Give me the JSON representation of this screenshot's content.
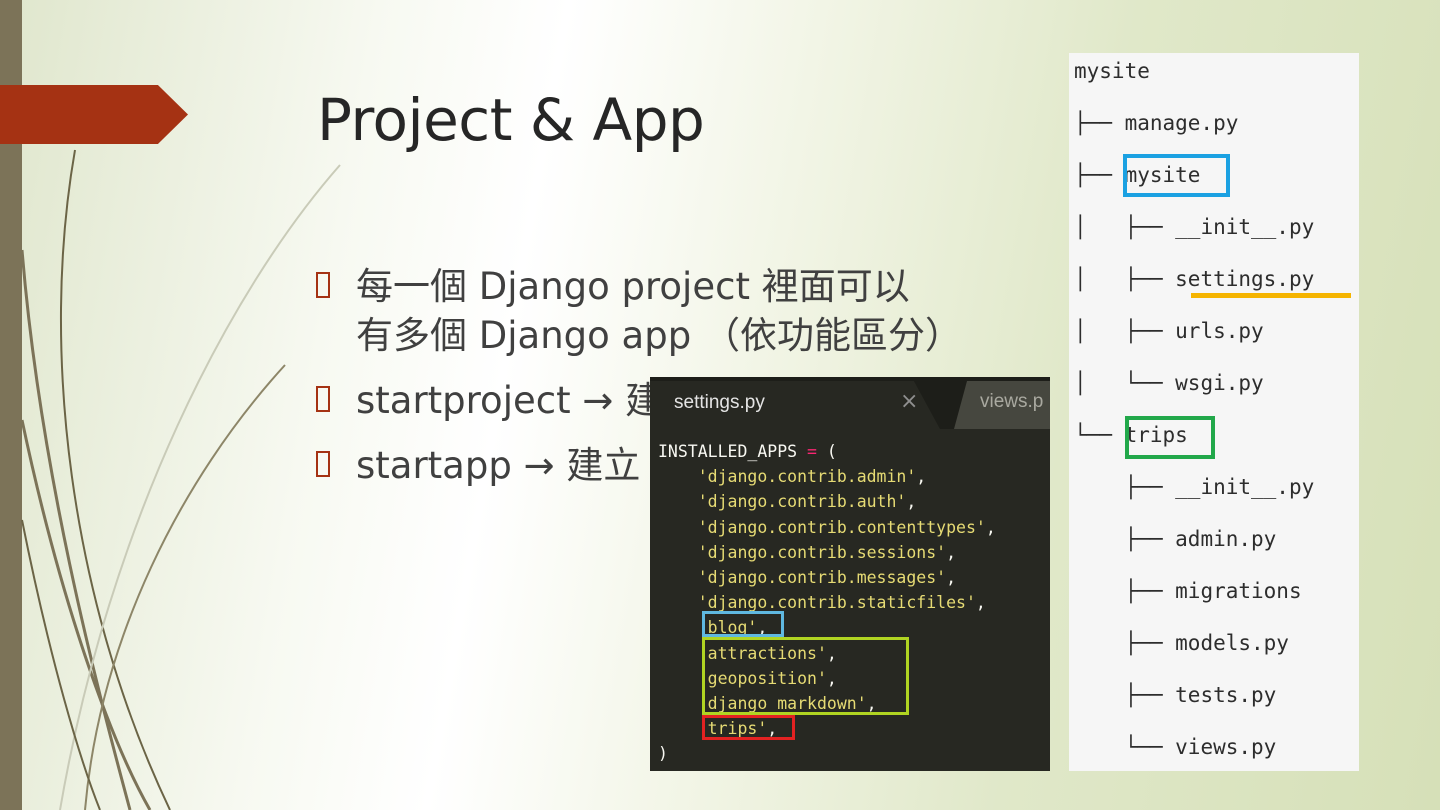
{
  "slide": {
    "title": "Project & App",
    "bullets": [
      {
        "text": "每一個 Django project 裡面可以\n有多個 Django app （依功能區分）"
      },
      {
        "text": "startproject →  建"
      },
      {
        "text": "startapp →  建立"
      }
    ]
  },
  "editor": {
    "active_tab": "settings.py",
    "close_glyph": "×",
    "inactive_tab": "views.p",
    "code_lines": [
      {
        "pre": "INSTALLED_APPS ",
        "op": "=",
        "post": " ("
      },
      {
        "ind": "    ",
        "str": "'django.contrib.admin'",
        "tail": ","
      },
      {
        "ind": "    ",
        "str": "'django.contrib.auth'",
        "tail": ","
      },
      {
        "ind": "    ",
        "str": "'django.contrib.contenttypes'",
        "tail": ","
      },
      {
        "ind": "    ",
        "str": "'django.contrib.sessions'",
        "tail": ","
      },
      {
        "ind": "    ",
        "str": "'django.contrib.messages'",
        "tail": ","
      },
      {
        "ind": "    ",
        "str": "'django.contrib.staticfiles'",
        "tail": ","
      },
      {
        "ind": "    ",
        "str": "'blog'",
        "tail": ","
      },
      {
        "ind": "    ",
        "str": "'attractions'",
        "tail": ","
      },
      {
        "ind": "    ",
        "str": "'geoposition'",
        "tail": ","
      },
      {
        "ind": "    ",
        "str": "'django_markdown'",
        "tail": ","
      },
      {
        "ind": "    ",
        "str": "'trips'",
        "tail": ","
      },
      {
        "pre": ")"
      }
    ],
    "highlight_colors": {
      "blog": "#5fb8e0",
      "third_party": "#b0d422",
      "trips": "#e32222"
    }
  },
  "file_tree": {
    "lines": [
      {
        "prefix": "",
        "name": "mysite"
      },
      {
        "prefix": "├── ",
        "name": "manage.py"
      },
      {
        "prefix": "├── ",
        "name": "mysite"
      },
      {
        "prefix": "│   ├── ",
        "name": "__init__.py"
      },
      {
        "prefix": "│   ├── ",
        "name": "settings.py"
      },
      {
        "prefix": "│   ├── ",
        "name": "urls.py"
      },
      {
        "prefix": "│   └── ",
        "name": "wsgi.py"
      },
      {
        "prefix": "└── ",
        "name": "trips"
      },
      {
        "prefix": "    ├── ",
        "name": "__init__.py"
      },
      {
        "prefix": "    ├── ",
        "name": "admin.py"
      },
      {
        "prefix": "    ├── ",
        "name": "migrations"
      },
      {
        "prefix": "    ├── ",
        "name": "models.py"
      },
      {
        "prefix": "    ├── ",
        "name": "tests.py"
      },
      {
        "prefix": "    └── ",
        "name": "views.py"
      }
    ],
    "highlight_colors": {
      "project_package": "#1ba1e2",
      "settings_underline": "#f5b400",
      "app_package": "#22a84a"
    }
  },
  "theme": {
    "accent": "#a53213",
    "side_bar": "#7c7358"
  }
}
